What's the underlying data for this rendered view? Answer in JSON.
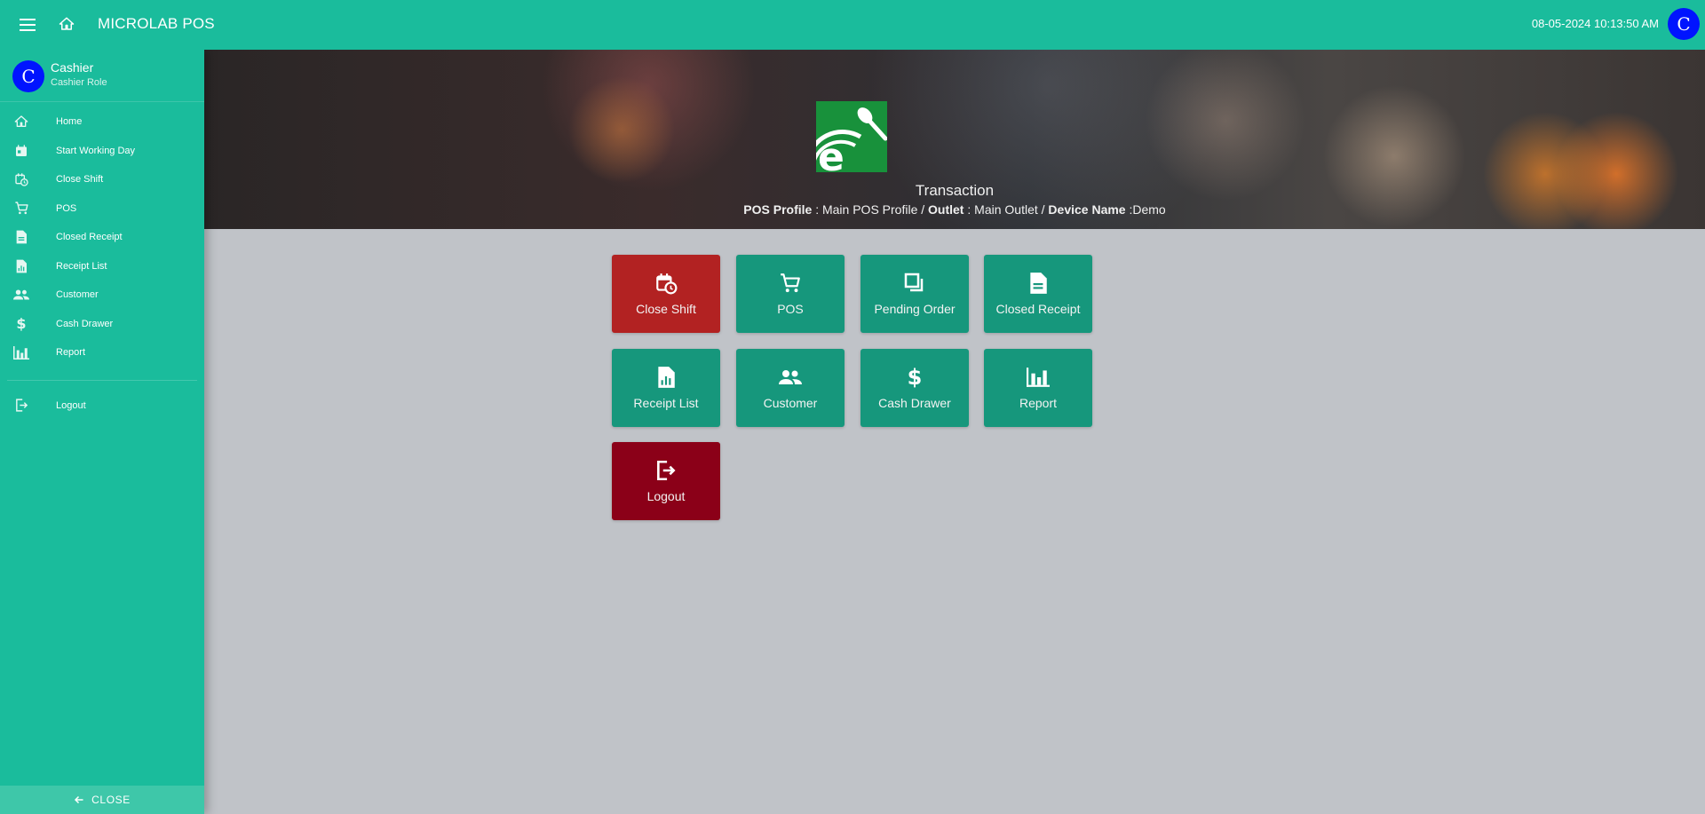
{
  "topbar": {
    "menu_icon": "menu-icon",
    "home_icon": "home-icon",
    "title": "MICROLAB POS",
    "datetime": "08-05-2024 10:13:50 AM",
    "avatar_letter": "C"
  },
  "sidebar": {
    "user": {
      "avatar_letter": "C",
      "name": "Cashier",
      "role": "Cashier Role"
    },
    "items": [
      {
        "label": "Home",
        "icon": "home-icon"
      },
      {
        "label": "Start Working Day",
        "icon": "calendar-icon"
      },
      {
        "label": "Close Shift",
        "icon": "calendar-clock-icon"
      },
      {
        "label": "POS",
        "icon": "cart-icon"
      },
      {
        "label": "Closed Receipt",
        "icon": "document-icon"
      },
      {
        "label": "Receipt List",
        "icon": "report-document-icon"
      },
      {
        "label": "Customer",
        "icon": "people-icon"
      },
      {
        "label": "Cash Drawer",
        "icon": "dollar-icon"
      },
      {
        "label": "Report",
        "icon": "bar-chart-icon"
      }
    ],
    "logout": {
      "label": "Logout",
      "icon": "logout-icon"
    },
    "close_label": "CLOSE"
  },
  "hero": {
    "title": "Transaction",
    "pos_profile_label": "POS Profile",
    "pos_profile_value": " : Main POS Profile / ",
    "outlet_label": "Outlet",
    "outlet_value": " : Main Outlet / ",
    "device_label": "Device Name",
    "device_value": " :Demo"
  },
  "tiles": [
    {
      "label": "Close Shift",
      "icon": "calendar-clock-icon",
      "color": "#b22222"
    },
    {
      "label": "POS",
      "icon": "cart-icon",
      "color": "#16977c"
    },
    {
      "label": "Pending Order",
      "icon": "copy-icon",
      "color": "#16977c"
    },
    {
      "label": "Closed Receipt",
      "icon": "document-icon",
      "color": "#16977c"
    },
    {
      "label": "Receipt List",
      "icon": "report-document-icon",
      "color": "#16977c"
    },
    {
      "label": "Customer",
      "icon": "people-icon",
      "color": "#16977c"
    },
    {
      "label": "Cash Drawer",
      "icon": "dollar-icon",
      "color": "#16977c"
    },
    {
      "label": "Report",
      "icon": "bar-chart-icon",
      "color": "#16977c"
    },
    {
      "label": "Logout",
      "icon": "logout-icon",
      "color": "#8b0018"
    }
  ],
  "colors": {
    "primary": "#1abc9c",
    "tile_green": "#16977c",
    "tile_red": "#b22222",
    "tile_darkred": "#8b0018",
    "avatar_blue": "#0014ff",
    "background": "#c0c3c8"
  }
}
